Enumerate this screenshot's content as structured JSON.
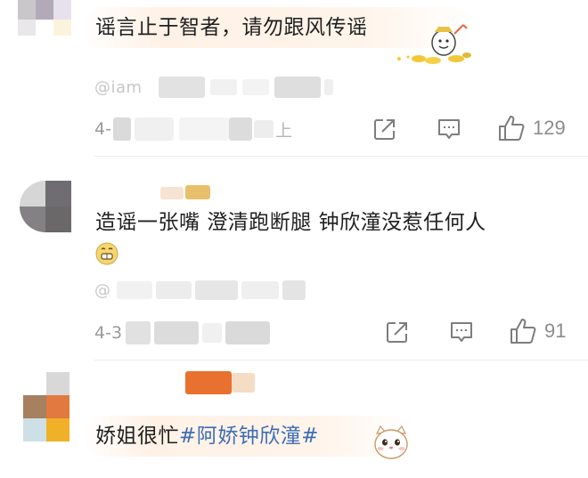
{
  "comments": [
    {
      "text": "谣言止于智者，请勿跟风传谣",
      "via_prefix": "@iam",
      "time_prefix": "4-",
      "time_suffix": "上",
      "icons": [
        "share-icon",
        "comment-icon",
        "like-icon"
      ],
      "like_count": "129",
      "sticker": "fortune-figure-sticker"
    },
    {
      "text": "造谣一张嘴 澄清跑断腿 钟欣潼没惹任何人",
      "emoji": "grin-emoji",
      "via_prefix": "@",
      "time_prefix": "4-3",
      "icons": [
        "share-icon",
        "comment-icon",
        "like-icon"
      ],
      "like_count": "91"
    },
    {
      "text_plain": "娇姐很忙",
      "hashtag": "#阿娇钟欣潼#",
      "sticker": "white-cat-sticker"
    }
  ],
  "colors": {
    "hashtag": "#3d6db5",
    "meta_gray": "#9a9a9a",
    "bubble": "#fff1e6"
  }
}
